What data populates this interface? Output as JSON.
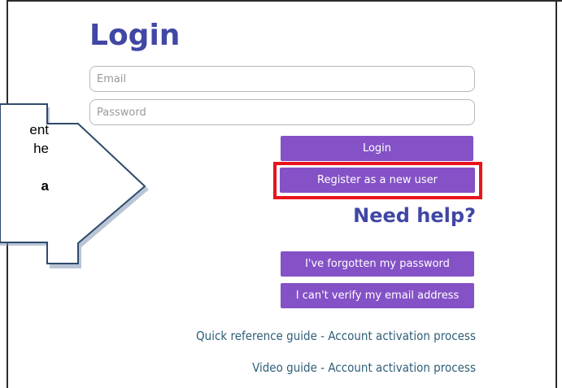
{
  "title": "Login",
  "form": {
    "email_placeholder": "Email",
    "password_placeholder": "Password",
    "login_label": "Login",
    "register_label": "Register as a new user"
  },
  "help": {
    "heading": "Need help?",
    "forgot_label": "I've forgotten my password",
    "verify_label": "I can't verify my email address"
  },
  "links": {
    "quick_reference": "Quick reference guide - Account activation process",
    "video_guide": "Video guide - Account activation process"
  },
  "callout": {
    "line1": "ent",
    "line2": "he",
    "line3": "",
    "line4": "a"
  },
  "colors": {
    "heading": "#4147a4",
    "button": "#8452c6",
    "highlight": "#e8141c",
    "link": "#2f5f7a"
  }
}
